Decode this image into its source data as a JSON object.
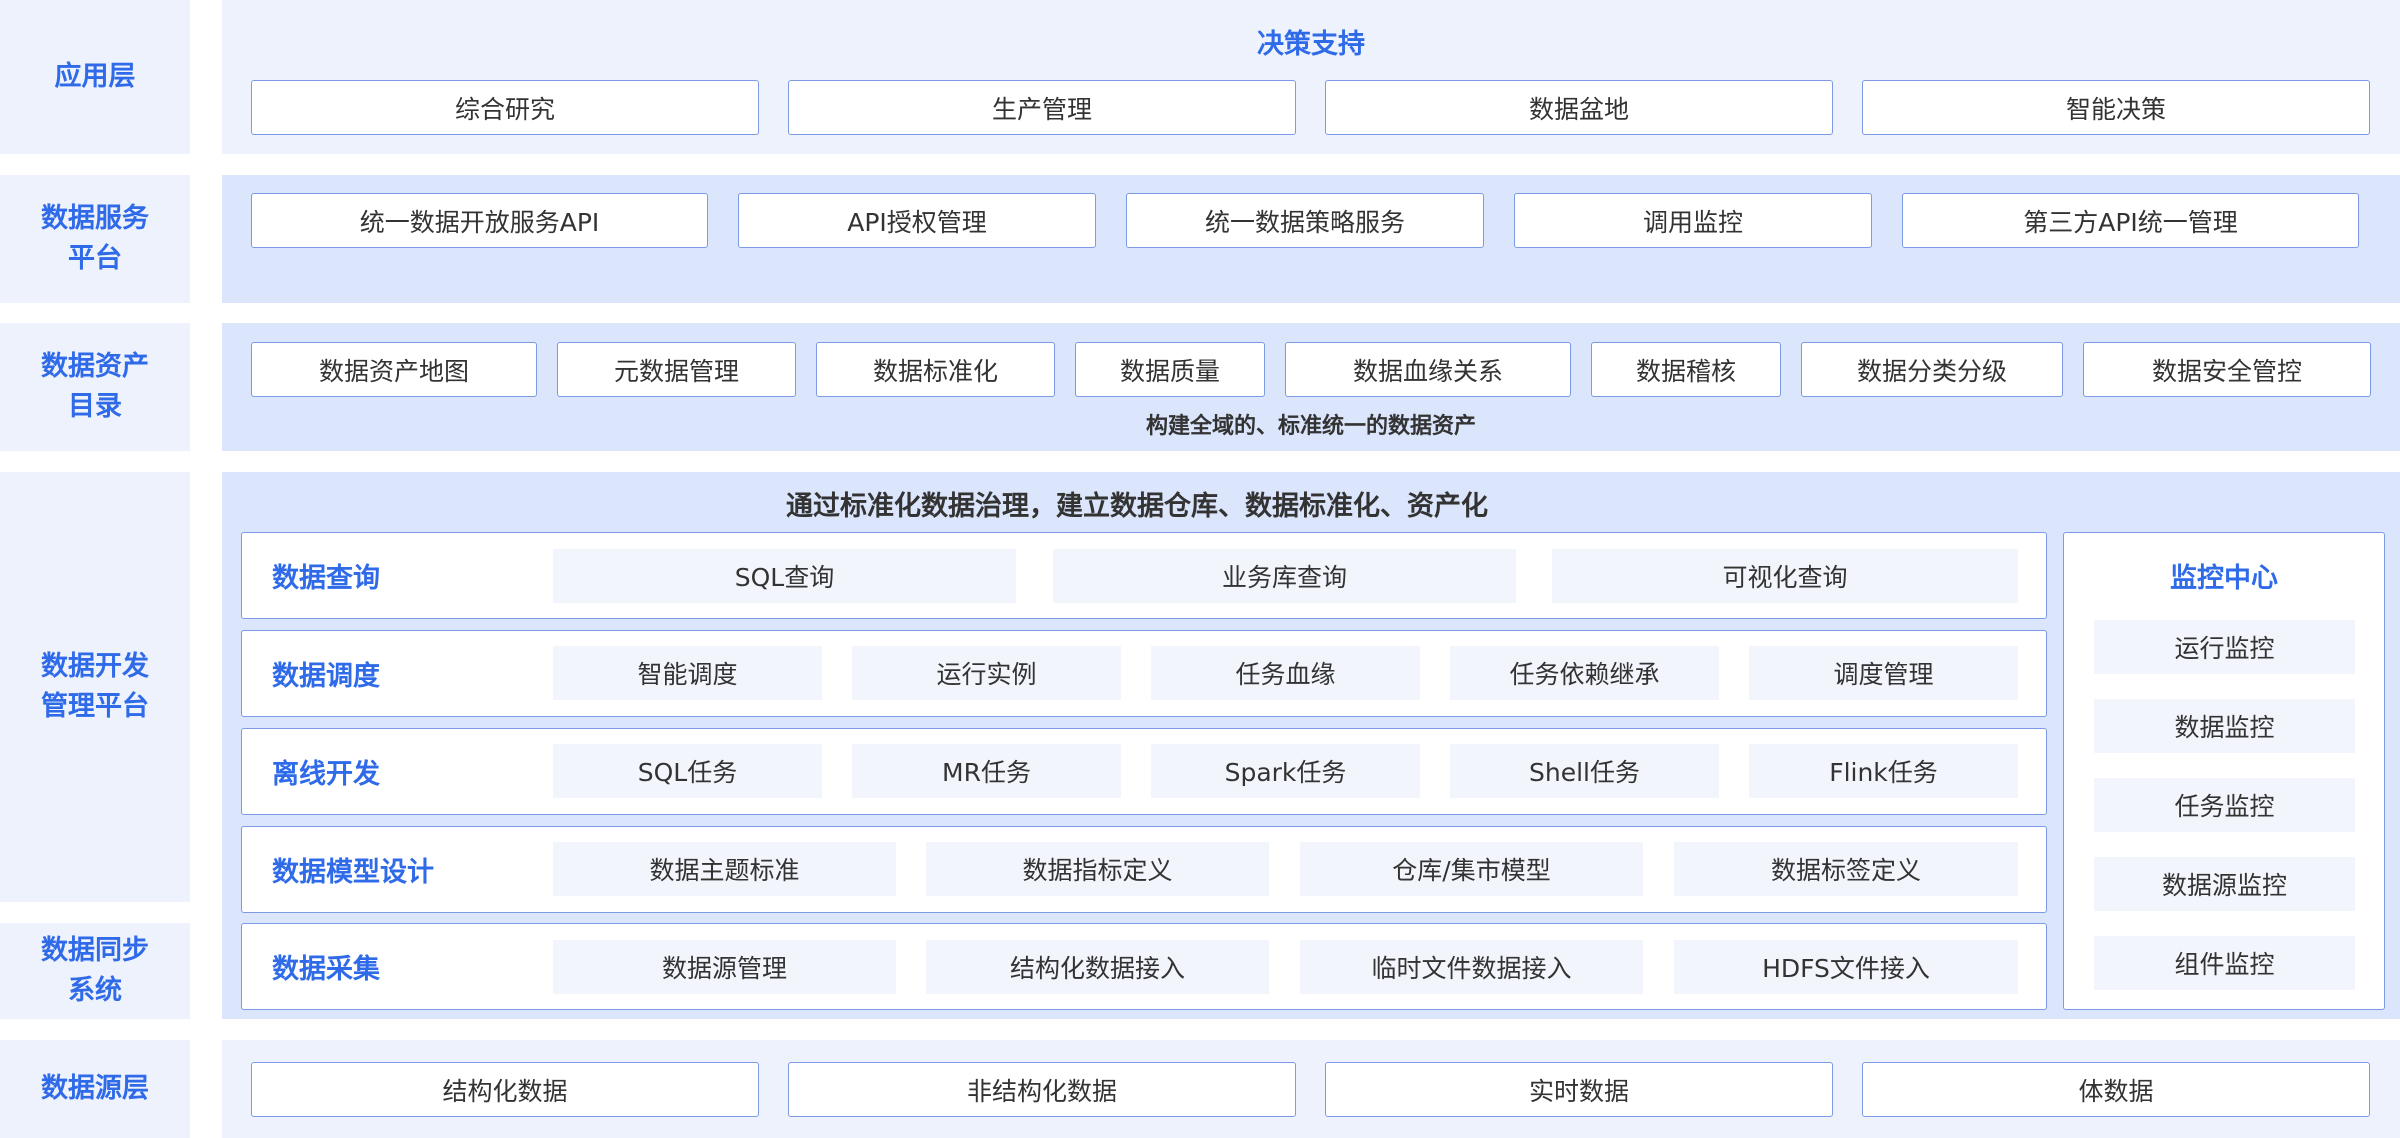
{
  "layers": {
    "application": "应用层",
    "service": [
      "数据服务",
      "平台"
    ],
    "catalog": [
      "数据资产",
      "目录"
    ],
    "dev": [
      "数据开发",
      "管理平台"
    ],
    "sync": [
      "数据同步",
      "系统"
    ],
    "source": "数据源层"
  },
  "application": {
    "title": "决策支持",
    "items": [
      "综合研究",
      "生产管理",
      "数据盆地",
      "智能决策"
    ]
  },
  "service": {
    "items": [
      "统一数据开放服务API",
      "API授权管理",
      "统一数据策略服务",
      "调用监控",
      "第三方API统一管理"
    ]
  },
  "catalog": {
    "items": [
      "数据资产地图",
      "元数据管理",
      "数据标准化",
      "数据质量",
      "数据血缘关系",
      "数据稽核",
      "数据分类分级",
      "数据安全管控"
    ],
    "caption": "构建全域的、标准统一的数据资产"
  },
  "dev": {
    "title": "通过标准化数据治理，建立数据仓库、数据标准化、资产化",
    "rows": [
      {
        "label": "数据查询",
        "items": [
          "SQL查询",
          "业务库查询",
          "可视化查询"
        ]
      },
      {
        "label": "数据调度",
        "items": [
          "智能调度",
          "运行实例",
          "任务血缘",
          "任务依赖继承",
          "调度管理"
        ]
      },
      {
        "label": "离线开发",
        "items": [
          "SQL任务",
          "MR任务",
          "Spark任务",
          "Shell任务",
          "Flink任务"
        ]
      },
      {
        "label": "数据模型设计",
        "items": [
          "数据主题标准",
          "数据指标定义",
          "仓库/集市模型",
          "数据标签定义"
        ]
      },
      {
        "label": "数据采集",
        "items": [
          "数据源管理",
          "结构化数据接入",
          "临时文件数据接入",
          "HDFS文件接入"
        ]
      }
    ],
    "monitor": {
      "title": "监控中心",
      "items": [
        "运行监控",
        "数据监控",
        "任务监控",
        "数据源监控",
        "组件监控"
      ]
    }
  },
  "source": {
    "items": [
      "结构化数据",
      "非结构化数据",
      "实时数据",
      "体数据"
    ]
  },
  "colors": {
    "accent": "#2f6ae8",
    "band_light": "#eef2fc",
    "band_mid": "#dbe5fb",
    "border": "#7c9ae6",
    "chip": "#f2f5fc"
  }
}
